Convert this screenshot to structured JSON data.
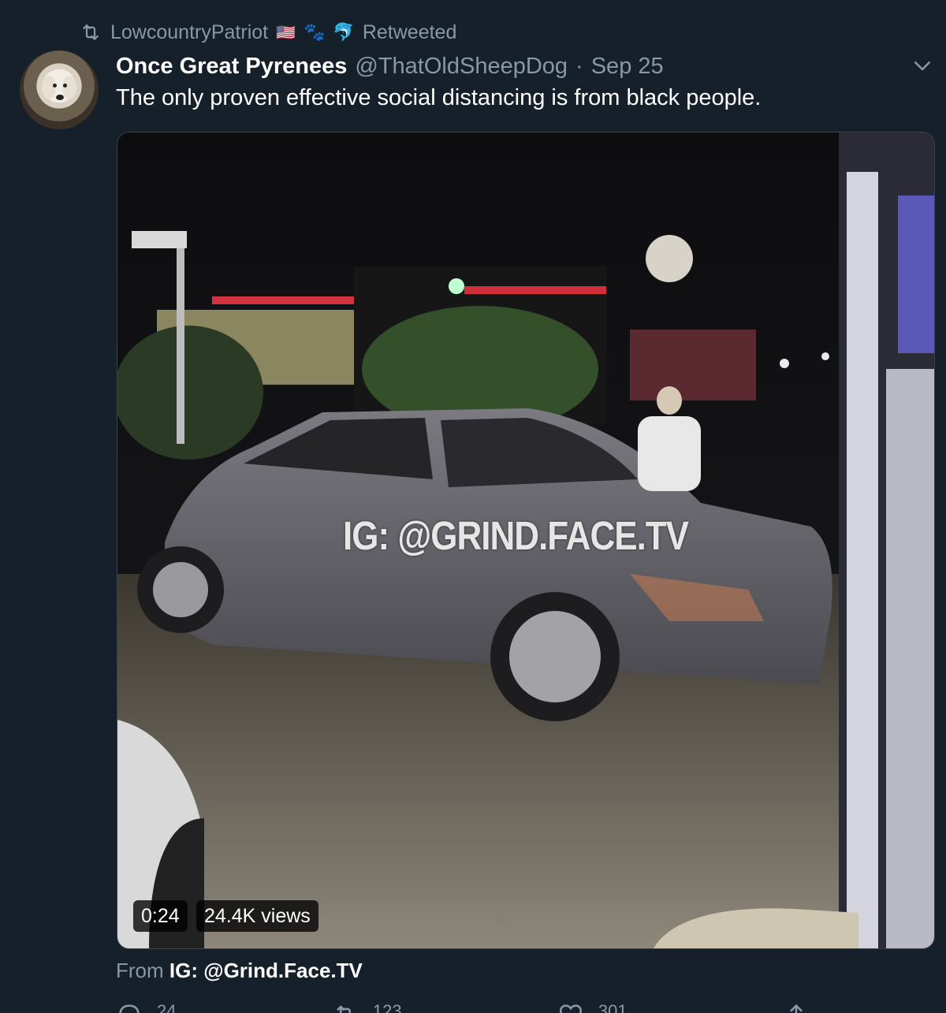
{
  "retweet_header": {
    "user": "LowcountryPatriot",
    "flag": "🇺🇸",
    "paw": "🐾",
    "dolphin": "🐬",
    "label": "Retweeted"
  },
  "tweet": {
    "display_name": "Once Great Pyrenees",
    "handle": "@ThatOldSheepDog",
    "separator": "·",
    "time": "Sep 25",
    "text": "The only proven effective social distancing is from black people."
  },
  "media": {
    "watermark": "IG: @GRIND.FACE.TV",
    "duration": "0:24",
    "views": "24.4K views"
  },
  "source": {
    "prefix": "From",
    "name": "IG: @Grind.Face.TV"
  },
  "actions": {
    "reply_count": "24",
    "retweet_count": "123",
    "like_count": "301"
  },
  "icons": {
    "retweet": "retweet-icon",
    "caret": "chevron-down-icon",
    "reply": "reply-icon",
    "like": "heart-icon",
    "share": "share-icon"
  },
  "colors": {
    "background": "#15202b",
    "secondary_text": "#8899a6",
    "border": "#38444d"
  }
}
